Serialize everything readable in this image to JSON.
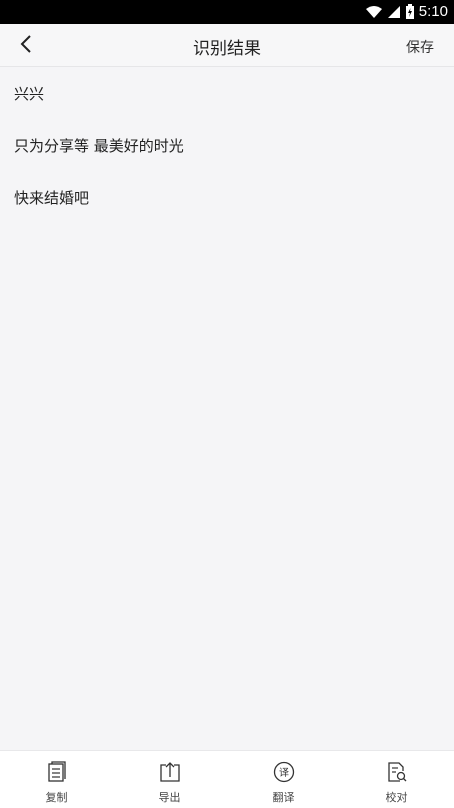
{
  "status": {
    "time": "5:10"
  },
  "nav": {
    "title": "识别结果",
    "save_label": "保存"
  },
  "result": {
    "lines": [
      "兴兴",
      "只为分享等 最美好的时光",
      "快来结婚吧"
    ]
  },
  "toolbar": {
    "items": [
      {
        "label": "复制",
        "icon": "copy-icon"
      },
      {
        "label": "导出",
        "icon": "export-icon"
      },
      {
        "label": "翻译",
        "icon": "translate-icon"
      },
      {
        "label": "校对",
        "icon": "proofread-icon"
      }
    ]
  }
}
